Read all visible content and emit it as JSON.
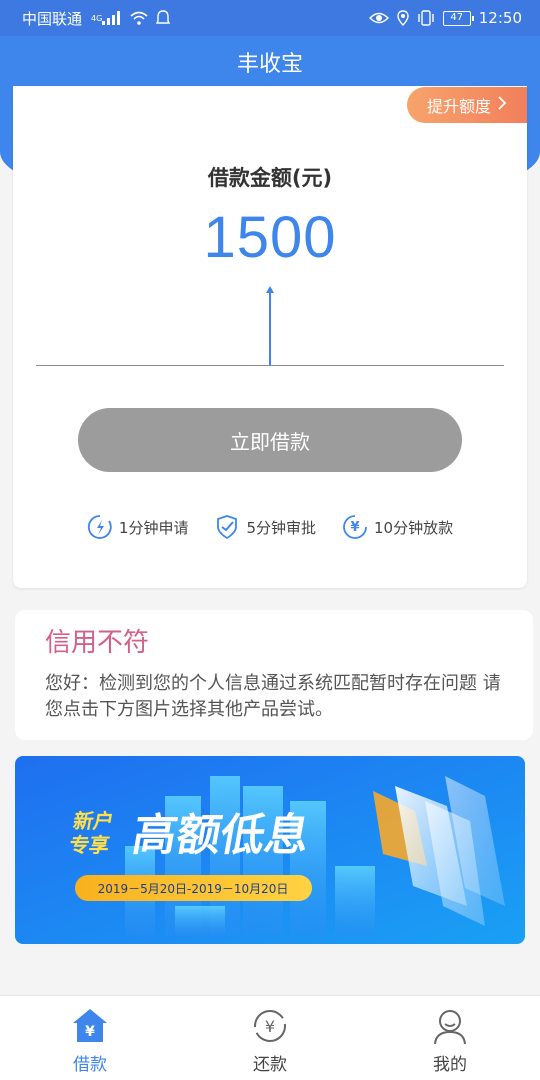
{
  "status_bar": {
    "carrier": "中国联通",
    "network": "4G",
    "battery": "47",
    "time": "12:50"
  },
  "header": {
    "title": "丰收宝"
  },
  "loan_card": {
    "raise_limit_label": "提升额度",
    "amount_label": "借款金额(元)",
    "amount_value": "1500",
    "borrow_button": "立即借款",
    "features": [
      {
        "label": "1分钟申请",
        "icon": "lightning-icon"
      },
      {
        "label": "5分钟审批",
        "icon": "shield-check-icon"
      },
      {
        "label": "10分钟放款",
        "icon": "yuan-icon"
      }
    ]
  },
  "notice": {
    "title": "信用不符",
    "text": "您好：检测到您的个人信息通过系统匹配暂时存在问题 请您点击下方图片选择其他产品尝试。"
  },
  "banner": {
    "tag_line1": "新户",
    "tag_line2": "专享",
    "headline": "高额低息",
    "date_range": "2019－5月20日-2019－10月20日"
  },
  "bottom_nav": {
    "items": [
      {
        "label": "借款",
        "icon": "house-yuan-icon",
        "active": true
      },
      {
        "label": "还款",
        "icon": "yuan-cycle-icon",
        "active": false
      },
      {
        "label": "我的",
        "icon": "user-icon",
        "active": false
      }
    ]
  },
  "colors": {
    "primary": "#3e86eb",
    "accent_orange": "#f27f5c",
    "notice_title": "#d4608a",
    "disabled_button": "#9c9c9c"
  }
}
